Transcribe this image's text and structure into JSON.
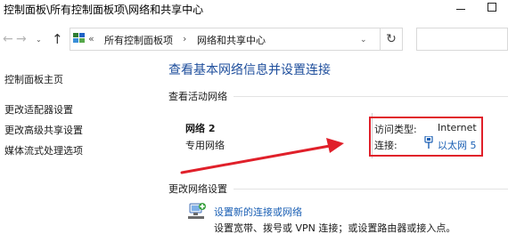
{
  "window": {
    "title": "控制面板\\所有控制面板项\\网络和共享中心"
  },
  "nav": {
    "back_glyph": "←",
    "forward_glyph": "→",
    "up_glyph": "↑",
    "refresh_glyph": "↻",
    "dropdown_glyph": "⌄"
  },
  "address": {
    "overflow": "«",
    "crumbs": [
      "所有控制面板项",
      "网络和共享中心"
    ],
    "separator": "›"
  },
  "sidebar": {
    "items": [
      {
        "label": "控制面板主页"
      },
      {
        "label": "更改适配器设置"
      },
      {
        "label": "更改高级共享设置"
      },
      {
        "label": "媒体流式处理选项"
      }
    ]
  },
  "main": {
    "heading": "查看基本网络信息并设置连接",
    "active_section": "查看活动网络",
    "network": {
      "name": "网络 2",
      "type": "专用网络",
      "access_label": "访问类型:",
      "access_value": "Internet",
      "connection_label": "连接:",
      "connection_value": "以太网 5"
    },
    "change_section": "更改网络设置",
    "setup": {
      "link": "设置新的连接或网络",
      "description": "设置宽带、拨号或 VPN 连接；或设置路由器或接入点。"
    }
  },
  "colors": {
    "link": "#1a5fb4",
    "heading": "#1e4e9c",
    "annotation": "#e0202a"
  },
  "icons": [
    "control-panel-icon",
    "ethernet-icon",
    "network-setup-icon"
  ]
}
